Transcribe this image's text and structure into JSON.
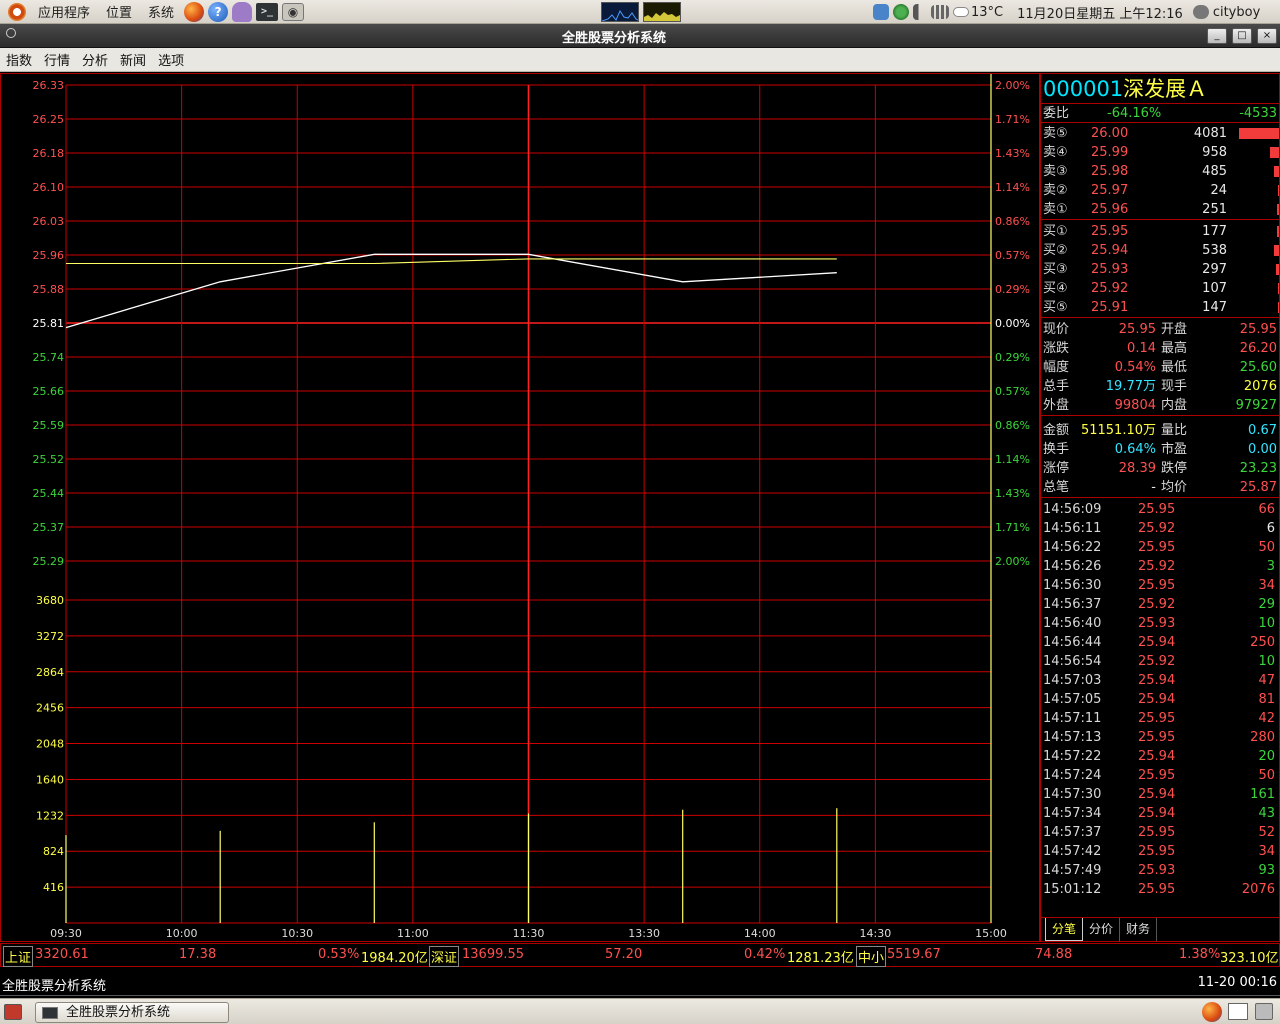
{
  "top_panel": {
    "menus": [
      "应用程序",
      "位置",
      "系统"
    ],
    "weather": "13°C",
    "datetime": "11月20日星期五 上午12:16",
    "user": "cityboy"
  },
  "window": {
    "title": "全胜股票分析系统",
    "controls": [
      "_",
      "□",
      "×"
    ]
  },
  "menubar": [
    "指数",
    "行情",
    "分析",
    "新闻",
    "选项"
  ],
  "chart_data": {
    "type": "line",
    "title": "",
    "x_ticks": [
      "09:30",
      "10:00",
      "10:30",
      "11:00",
      "11:30",
      "13:30",
      "14:00",
      "14:30",
      "15:00"
    ],
    "price_axis_left": [
      "26.33",
      "26.25",
      "26.18",
      "26.10",
      "26.03",
      "25.96",
      "25.88",
      "25.81",
      "25.74",
      "25.66",
      "25.59",
      "25.52",
      "25.44",
      "25.37",
      "25.29"
    ],
    "pct_axis_right": [
      "2.00%",
      "1.71%",
      "1.43%",
      "1.14%",
      "0.86%",
      "0.57%",
      "0.29%",
      "0.00%",
      "0.29%",
      "0.57%",
      "0.86%",
      "1.14%",
      "1.43%",
      "1.71%",
      "2.00%"
    ],
    "volume_axis_left": [
      "3680",
      "3272",
      "2864",
      "2456",
      "2048",
      "1640",
      "1232",
      "824",
      "416"
    ],
    "ylim": [
      25.29,
      26.33
    ],
    "prev_close": 25.81,
    "series": [
      {
        "name": "",
        "color": "#ffffff",
        "values": [
          25.8,
          25.9,
          25.96,
          25.96,
          25.9,
          25.92,
          "…"
        ]
      },
      {
        "name": "",
        "color": "#ffff66",
        "values": [
          25.94,
          25.94,
          25.94,
          25.95,
          25.95,
          25.95,
          "…"
        ]
      }
    ],
    "volume": {
      "ylim": [
        0,
        3680
      ],
      "color": "#ffff66",
      "values": [
        1001,
        1050,
        1147,
        1247,
        1291,
        1308,
        "…"
      ]
    }
  },
  "quote": {
    "code": "000001",
    "name": "深发展Ａ",
    "weibi": {
      "label": "委比",
      "pct": "-64.16%",
      "diff": "-4533"
    },
    "sell": [
      {
        "label": "卖⑤",
        "price": "26.00",
        "vol": "4081",
        "bar": 1.0
      },
      {
        "label": "卖④",
        "price": "25.99",
        "vol": "958",
        "bar": 0.235
      },
      {
        "label": "卖③",
        "price": "25.98",
        "vol": "485",
        "bar": 0.119
      },
      {
        "label": "卖②",
        "price": "25.97",
        "vol": "24",
        "bar": 0.006
      },
      {
        "label": "卖①",
        "price": "25.96",
        "vol": "251",
        "bar": 0.062
      }
    ],
    "buy": [
      {
        "label": "买①",
        "price": "25.95",
        "vol": "177",
        "bar": 0.043
      },
      {
        "label": "买②",
        "price": "25.94",
        "vol": "538",
        "bar": 0.132
      },
      {
        "label": "买③",
        "price": "25.93",
        "vol": "297",
        "bar": 0.073
      },
      {
        "label": "买④",
        "price": "25.92",
        "vol": "107",
        "bar": 0.026
      },
      {
        "label": "买⑤",
        "price": "25.91",
        "vol": "147",
        "bar": 0.036
      }
    ],
    "stats1": [
      {
        "l1": "现价",
        "v1": "25.95",
        "c1": "red",
        "l2": "开盘",
        "v2": "25.95",
        "c2": "red"
      },
      {
        "l1": "涨跌",
        "v1": "0.14",
        "c1": "red",
        "l2": "最高",
        "v2": "26.20",
        "c2": "red"
      },
      {
        "l1": "幅度",
        "v1": "0.54%",
        "c1": "red",
        "l2": "最低",
        "v2": "25.60",
        "c2": "green"
      },
      {
        "l1": "总手",
        "v1": "19.77万",
        "c1": "cyan",
        "l2": "现手",
        "v2": "2076",
        "c2": "yellow"
      },
      {
        "l1": "外盘",
        "v1": "99804",
        "c1": "red",
        "l2": "内盘",
        "v2": "97927",
        "c2": "green"
      }
    ],
    "stats2": [
      {
        "l1": "金额",
        "v1": "51151.10万",
        "c1": "yellow",
        "l2": "量比",
        "v2": "0.67",
        "c2": "cyan"
      },
      {
        "l1": "换手",
        "v1": "0.64%",
        "c1": "cyan",
        "l2": "市盈",
        "v2": "0.00",
        "c2": "cyan"
      },
      {
        "l1": "涨停",
        "v1": "28.39",
        "c1": "red",
        "l2": "跌停",
        "v2": "23.23",
        "c2": "green"
      },
      {
        "l1": "总笔",
        "v1": "-",
        "c1": "white",
        "l2": "均价",
        "v2": "25.87",
        "c2": "red"
      }
    ],
    "ticks": [
      {
        "time": "14:56:09",
        "price": "25.95",
        "vol": "66",
        "vc": "red"
      },
      {
        "time": "14:56:11",
        "price": "25.92",
        "vol": "6",
        "vc": "white"
      },
      {
        "time": "14:56:22",
        "price": "25.95",
        "vol": "50",
        "vc": "red"
      },
      {
        "time": "14:56:26",
        "price": "25.92",
        "vol": "3",
        "vc": "green"
      },
      {
        "time": "14:56:30",
        "price": "25.95",
        "vol": "34",
        "vc": "red"
      },
      {
        "time": "14:56:37",
        "price": "25.92",
        "vol": "29",
        "vc": "green"
      },
      {
        "time": "14:56:40",
        "price": "25.93",
        "vol": "10",
        "vc": "green"
      },
      {
        "time": "14:56:44",
        "price": "25.94",
        "vol": "250",
        "vc": "red"
      },
      {
        "time": "14:56:54",
        "price": "25.92",
        "vol": "10",
        "vc": "green"
      },
      {
        "time": "14:57:03",
        "price": "25.94",
        "vol": "47",
        "vc": "red"
      },
      {
        "time": "14:57:05",
        "price": "25.94",
        "vol": "81",
        "vc": "red"
      },
      {
        "time": "14:57:11",
        "price": "25.95",
        "vol": "42",
        "vc": "red"
      },
      {
        "time": "14:57:13",
        "price": "25.95",
        "vol": "280",
        "vc": "red"
      },
      {
        "time": "14:57:22",
        "price": "25.94",
        "vol": "20",
        "vc": "green"
      },
      {
        "time": "14:57:24",
        "price": "25.95",
        "vol": "50",
        "vc": "red"
      },
      {
        "time": "14:57:30",
        "price": "25.94",
        "vol": "161",
        "vc": "green"
      },
      {
        "time": "14:57:34",
        "price": "25.94",
        "vol": "43",
        "vc": "green"
      },
      {
        "time": "14:57:37",
        "price": "25.95",
        "vol": "52",
        "vc": "red"
      },
      {
        "time": "14:57:42",
        "price": "25.95",
        "vol": "34",
        "vc": "red"
      },
      {
        "time": "14:57:49",
        "price": "25.93",
        "vol": "93",
        "vc": "green"
      },
      {
        "time": "15:01:12",
        "price": "25.95",
        "vol": "2076",
        "vc": "red"
      }
    ],
    "tabs": [
      "分笔",
      "分价",
      "财务"
    ]
  },
  "indexbar": [
    {
      "tag": "上证",
      "value": "3320.61",
      "change": "17.38",
      "pct": "0.53%",
      "amount": "1984.20亿"
    },
    {
      "tag": "深证",
      "value": "13699.55",
      "change": "57.20",
      "pct": "0.42%",
      "amount": "1281.23亿"
    },
    {
      "tag": "中小",
      "value": "5519.67",
      "change": "74.88",
      "pct": "1.38%",
      "amount": "323.10亿"
    }
  ],
  "app_status": {
    "left": "全胜股票分析系统",
    "right": "11-20 00:16"
  },
  "taskbar": {
    "task": "全胜股票分析系统"
  },
  "colors": {
    "up": "#ff5050",
    "down": "#3cd63c",
    "grid": "#cc0000",
    "price_line": "#ffffff",
    "avg_line": "#ffff66",
    "volume": "#ffff66"
  }
}
